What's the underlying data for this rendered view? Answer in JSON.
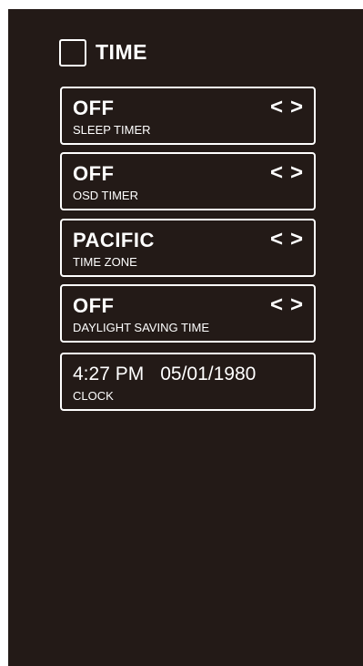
{
  "menu": {
    "title": "TIME"
  },
  "settings": [
    {
      "value": "OFF",
      "label": "SLEEP TIMER"
    },
    {
      "value": "OFF",
      "label": "OSD TIMER"
    },
    {
      "value": "PACIFIC",
      "label": "TIME ZONE"
    },
    {
      "value": "OFF",
      "label": "DAYLIGHT SAVING TIME"
    }
  ],
  "arrows": {
    "left": "<",
    "right": ">"
  },
  "clock": {
    "time": "4:27 PM",
    "date": "05/01/1980",
    "label": "CLOCK"
  }
}
